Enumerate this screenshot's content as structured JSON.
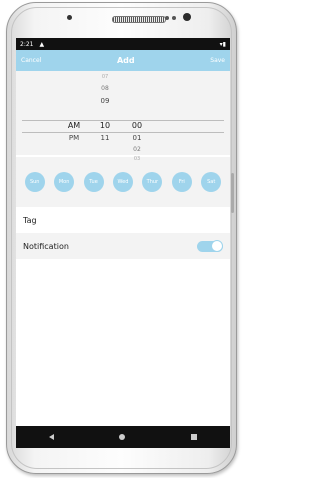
{
  "status": {
    "time": "2:21"
  },
  "appbar": {
    "cancel": "Cancel",
    "title": "Add",
    "save": "Save"
  },
  "picker": {
    "period": {
      "selected": "AM",
      "next": "PM"
    },
    "hours": {
      "faint": "07",
      "above2": "08",
      "above1": "09",
      "selected": "10",
      "below1": "11"
    },
    "minutes": {
      "selected": "00",
      "below1": "01",
      "below2": "02",
      "faint": "03"
    }
  },
  "days": [
    "Sun",
    "Mon",
    "Tue",
    "Wed",
    "Thur",
    "Fri",
    "Sat"
  ],
  "tag": {
    "label": "Tag"
  },
  "notification": {
    "label": "Notification",
    "enabled": true
  },
  "colors": {
    "accent": "#9fd4ec",
    "bar": "#111111"
  }
}
